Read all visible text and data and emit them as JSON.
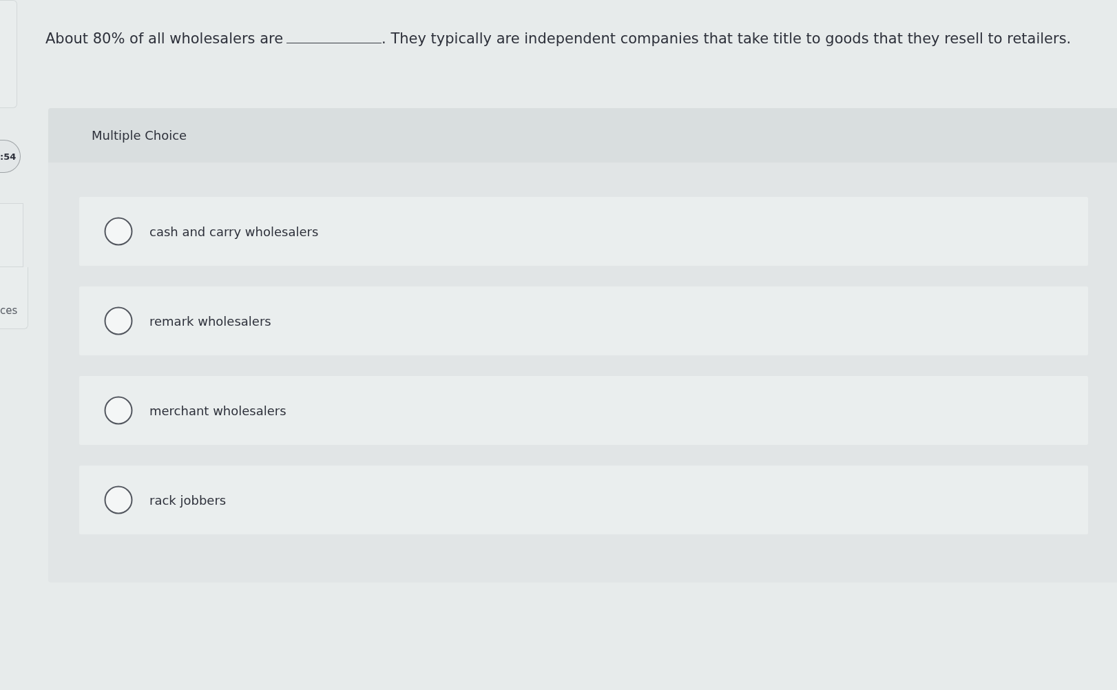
{
  "sidebar": {
    "timer": ":54",
    "items": [
      "ces"
    ]
  },
  "question": {
    "before": "About 80% of all wholesalers are",
    "after": ". They typically are independent companies that take title to goods that they resell to retailers."
  },
  "answer_area": {
    "title": "Multiple Choice",
    "options": [
      {
        "label": "cash and carry wholesalers",
        "selected": false
      },
      {
        "label": "remark wholesalers",
        "selected": false
      },
      {
        "label": "merchant wholesalers",
        "selected": false
      },
      {
        "label": "rack jobbers",
        "selected": false
      }
    ]
  }
}
